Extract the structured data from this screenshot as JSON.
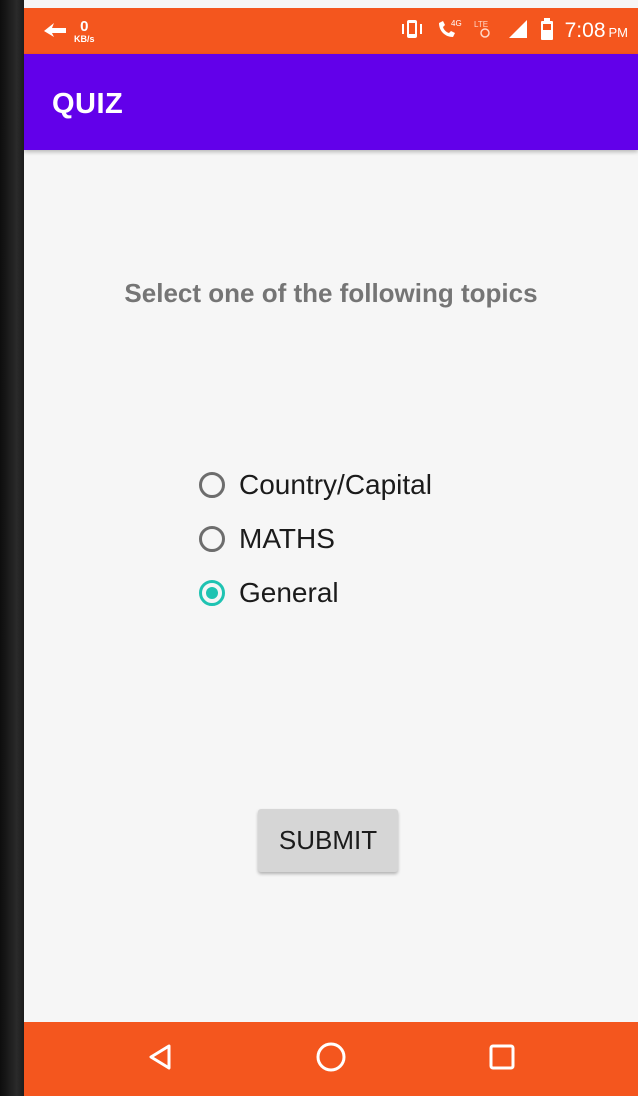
{
  "status_bar": {
    "net_speed_value": "0",
    "net_speed_unit": "KB/s",
    "time": "7:08",
    "ampm": "PM",
    "icons": [
      "network-speed-icon",
      "vibrate-icon",
      "volte-4g-icon",
      "lte-icon",
      "signal-icon",
      "battery-icon"
    ]
  },
  "app_bar": {
    "title": "QUIZ"
  },
  "main": {
    "prompt": "Select one of the following topics",
    "options": [
      {
        "label": "Country/Capital",
        "checked": false
      },
      {
        "label": "MATHS",
        "checked": false
      },
      {
        "label": "General",
        "checked": true
      }
    ],
    "submit_label": "SUBMIT"
  },
  "nav_bar": {
    "icons": [
      "back-icon",
      "home-icon",
      "recents-icon"
    ]
  },
  "colors": {
    "status_nav_bar": "#f4561e",
    "app_bar": "#6200ea",
    "radio_checked": "#1fc3b2",
    "background": "#f6f6f6"
  }
}
